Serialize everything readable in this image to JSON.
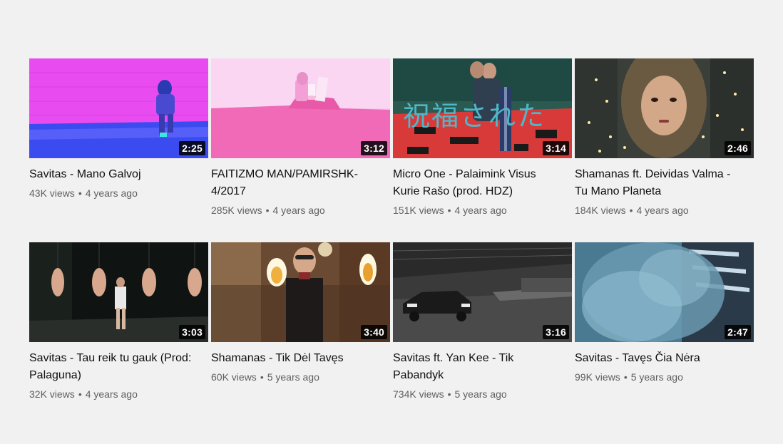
{
  "videos": [
    {
      "title": "Savitas - Mano Galvoj",
      "duration": "2:25",
      "views": "43K views",
      "age": "4 years ago"
    },
    {
      "title": "FAITIZMO MAN/PAMIRSHK-4/2017",
      "duration": "3:12",
      "views": "285K views",
      "age": "4 years ago"
    },
    {
      "title": "Micro One - Palaimink Visus Kurie Rašo (prod. HDZ)",
      "duration": "3:14",
      "views": "151K views",
      "age": "4 years ago",
      "overlay_text": "祝福された"
    },
    {
      "title": "Shamanas ft. Deividas Valma - Tu Mano Planeta",
      "duration": "2:46",
      "views": "184K views",
      "age": "4 years ago"
    },
    {
      "title": "Savitas - Tau reik tu gauk (Prod: Palaguna)",
      "duration": "3:03",
      "views": "32K views",
      "age": "4 years ago"
    },
    {
      "title": "Shamanas - Tik Dėl Tavęs",
      "duration": "3:40",
      "views": "60K views",
      "age": "5 years ago"
    },
    {
      "title": "Savitas ft. Yan Kee - Tik Pabandyk",
      "duration": "3:16",
      "views": "734K views",
      "age": "5 years ago"
    },
    {
      "title": "Savitas - Tavęs Čia Nėra",
      "duration": "2:47",
      "views": "99K views",
      "age": "5 years ago"
    }
  ],
  "separator": "•",
  "colors": {
    "background": "#f1f1f1",
    "title": "#0f0f0f",
    "meta": "#606060"
  }
}
